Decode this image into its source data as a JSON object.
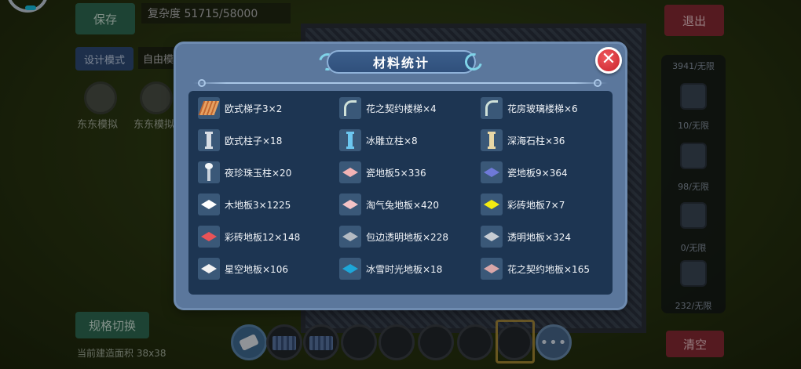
{
  "hud": {
    "save_label": "保存",
    "complexity_text": "复杂度 51715/58000",
    "design_mode_label": "设计模式",
    "mode_value": "自由模式",
    "exit_label": "退出",
    "round_left_label": "东东模拟",
    "round_right_label": "东东模拟",
    "spec_switch_label": "规格切换",
    "current_area_text": "当前建造面积 38x38",
    "clear_label": "清空"
  },
  "right_panel": {
    "items": [
      {
        "label": "3941/无限"
      },
      {
        "label": "10/无限"
      },
      {
        "label": "98/无限"
      },
      {
        "label": "0/无限"
      },
      {
        "label": "232/无限"
      }
    ]
  },
  "hotbar": {
    "more_label": "•••"
  },
  "dialog": {
    "title": "材料统计",
    "close_glyph": "✕",
    "materials": [
      {
        "label": "欧式梯子3×2",
        "icon": "ladder-icon",
        "color": "#d98040"
      },
      {
        "label": "花之契约楼梯×4",
        "icon": "stair-icon",
        "color": "#cfe1d9"
      },
      {
        "label": "花房玻璃楼梯×6",
        "icon": "stair-icon",
        "color": "#cfe1d9"
      },
      {
        "label": "欧式柱子×18",
        "icon": "pillar-icon",
        "color": "#d7dde4"
      },
      {
        "label": "冰雕立柱×8",
        "icon": "pillar-icon",
        "color": "#6cc6ef"
      },
      {
        "label": "深海石柱×36",
        "icon": "pillar-icon",
        "color": "#e8d7a6"
      },
      {
        "label": "夜珍珠玉柱×20",
        "icon": "pole-icon",
        "color": "#c9d2dc"
      },
      {
        "label": "瓷地板5×336",
        "icon": "tile-icon",
        "color": "#f2b3b5"
      },
      {
        "label": "瓷地板9×364",
        "icon": "tile-icon",
        "color": "#6e79d8"
      },
      {
        "label": "木地板3×1225",
        "icon": "tile-icon",
        "color": "#ffffff"
      },
      {
        "label": "淘气兔地板×420",
        "icon": "tile-icon",
        "color": "#f4c3c6"
      },
      {
        "label": "彩砖地板7×7",
        "icon": "tile-icon",
        "color": "#f2ea12"
      },
      {
        "label": "彩砖地板12×148",
        "icon": "tile-icon",
        "color": "#e95357"
      },
      {
        "label": "包边透明地板×228",
        "icon": "tile-icon",
        "color": "#b4bbc3"
      },
      {
        "label": "透明地板×324",
        "icon": "tile-icon",
        "color": "#c6ccd3"
      },
      {
        "label": "星空地板×106",
        "icon": "tile-icon",
        "color": "#f2f2f2"
      },
      {
        "label": "冰雪时光地板×18",
        "icon": "tile-icon",
        "color": "#1da6d8"
      },
      {
        "label": "花之契约地板×165",
        "icon": "tile-icon",
        "color": "#d9a7a9"
      }
    ]
  }
}
